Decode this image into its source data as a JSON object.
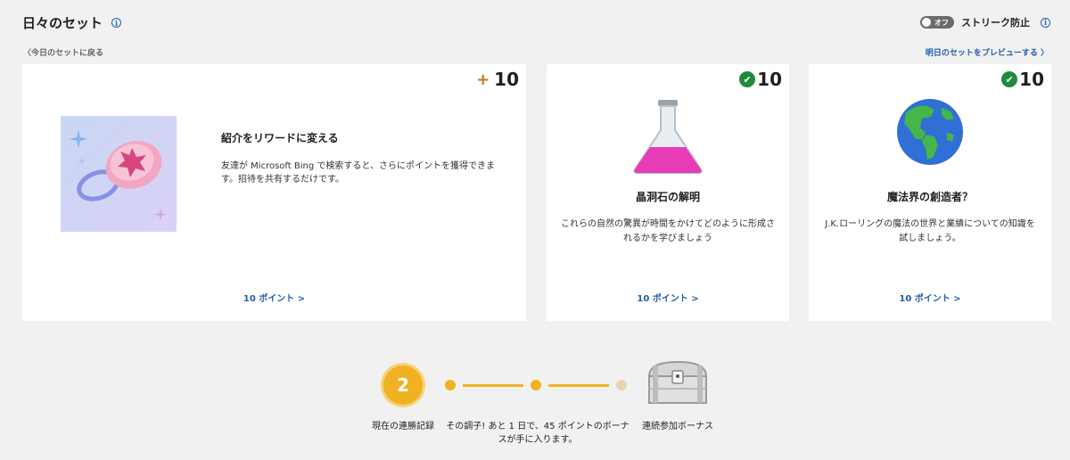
{
  "header": {
    "title": "日々のセット"
  },
  "streak_protect": {
    "toggle_state": "オフ",
    "label": "ストリーク防止"
  },
  "nav": {
    "back": "今日のセットに戻る",
    "next": "明日のセットをプレビューする"
  },
  "cards": [
    {
      "title": "紹介をリワードに変える",
      "desc": "友達が Microsoft Bing で検索すると、さらにポイントを獲得できます。招待を共有するだけです。",
      "points": "10",
      "link": "10 ポイント >"
    },
    {
      "title": "晶洞石の解明",
      "desc": "これらの自然の驚異が時間をかけてどのように形成されるかを学びましょう",
      "points": "10",
      "link": "10 ポイント >"
    },
    {
      "title": "魔法界の創造者？",
      "desc": "J.K.ローリングの魔法の世界と業績についての知識を試しましょう。",
      "points": "10",
      "link": "10 ポイント >"
    }
  ],
  "streak": {
    "count": "2",
    "current_label": "現在の連勝記録",
    "progress_text": "その調子! あと 1 日で、45 ポイントのボーナスが手に入ります。",
    "bonus_label": "連続参加ボーナス"
  },
  "colors": {
    "accent": "#1f5fa8",
    "streak": "#f0b222",
    "check": "#1e8a3c",
    "plus": "#c27a12"
  }
}
